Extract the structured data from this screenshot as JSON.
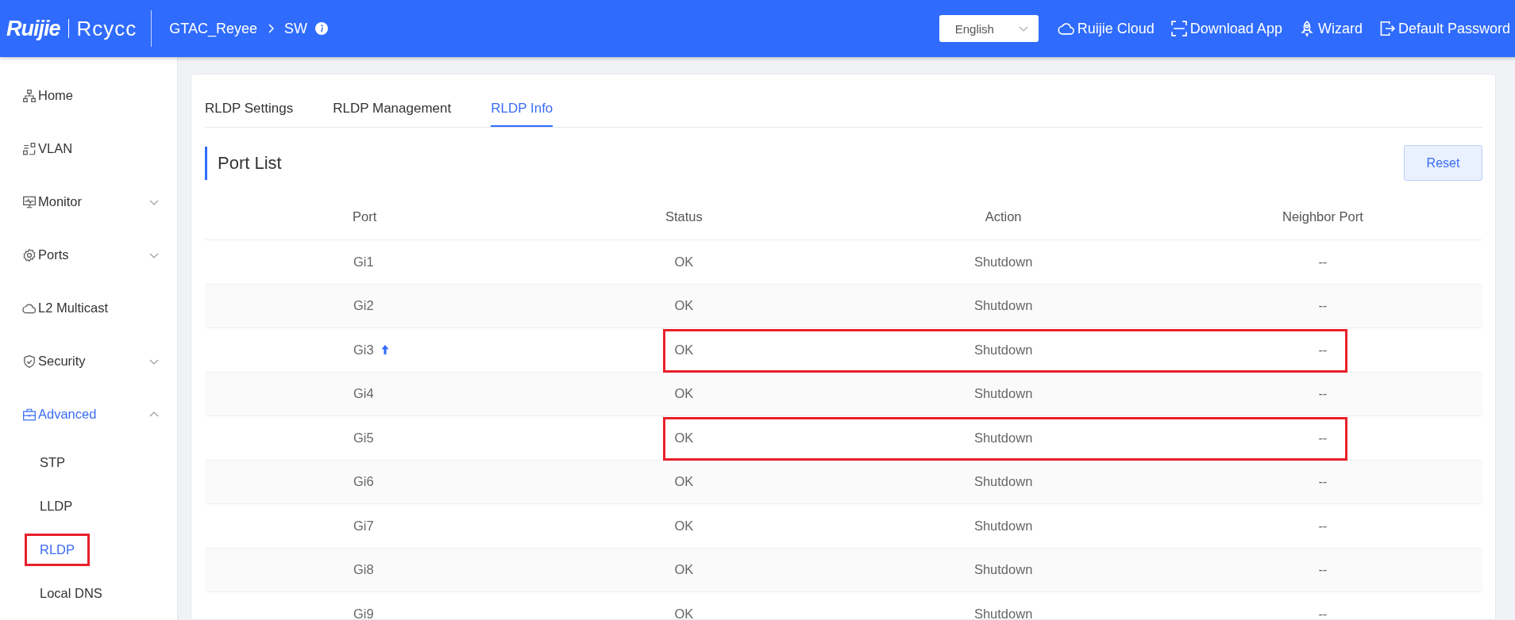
{
  "header": {
    "logo": {
      "brand": "Ruijie",
      "product": "Rcycc"
    },
    "breadcrumb": [
      {
        "label": "GTAC_Reyee"
      },
      {
        "label": "SW"
      }
    ],
    "language": {
      "value": "English"
    },
    "links": [
      {
        "label": "Ruijie Cloud"
      },
      {
        "label": "Download App"
      },
      {
        "label": "Wizard"
      },
      {
        "label": "Default Password"
      }
    ]
  },
  "sidebar": {
    "items": [
      {
        "label": "Home",
        "kind": "link",
        "selected": false
      },
      {
        "label": "VLAN",
        "kind": "link",
        "selected": false
      },
      {
        "label": "Monitor",
        "kind": "group",
        "selected": false,
        "expanded": false
      },
      {
        "label": "Ports",
        "kind": "group",
        "selected": false,
        "expanded": false
      },
      {
        "label": "L2 Multicast",
        "kind": "link",
        "selected": false
      },
      {
        "label": "Security",
        "kind": "group",
        "selected": false,
        "expanded": false
      },
      {
        "label": "Advanced",
        "kind": "group",
        "selected": true,
        "expanded": true,
        "children": [
          {
            "label": "STP",
            "selected": false,
            "highlighted": false
          },
          {
            "label": "LLDP",
            "selected": false,
            "highlighted": false
          },
          {
            "label": "RLDP",
            "selected": true,
            "highlighted": true
          },
          {
            "label": "Local DNS",
            "selected": false,
            "highlighted": false
          }
        ]
      }
    ]
  },
  "tabs": [
    {
      "label": "RLDP Settings",
      "selected": false
    },
    {
      "label": "RLDP Management",
      "selected": false
    },
    {
      "label": "RLDP Info",
      "selected": true
    }
  ],
  "section": {
    "title": "Port List",
    "reset_button": "Reset"
  },
  "table": {
    "columns": [
      "Port",
      "Status",
      "Action",
      "Neighbor Port"
    ],
    "rows": [
      {
        "port": "Gi1",
        "uplink": false,
        "status": "OK",
        "action": "Shutdown",
        "neighbor": "--",
        "highlighted": false
      },
      {
        "port": "Gi2",
        "uplink": false,
        "status": "OK",
        "action": "Shutdown",
        "neighbor": "--",
        "highlighted": false
      },
      {
        "port": "Gi3",
        "uplink": true,
        "status": "OK",
        "action": "Shutdown",
        "neighbor": "--",
        "highlighted": true
      },
      {
        "port": "Gi4",
        "uplink": false,
        "status": "OK",
        "action": "Shutdown",
        "neighbor": "--",
        "highlighted": false
      },
      {
        "port": "Gi5",
        "uplink": false,
        "status": "OK",
        "action": "Shutdown",
        "neighbor": "--",
        "highlighted": true
      },
      {
        "port": "Gi6",
        "uplink": false,
        "status": "OK",
        "action": "Shutdown",
        "neighbor": "--",
        "highlighted": false
      },
      {
        "port": "Gi7",
        "uplink": false,
        "status": "OK",
        "action": "Shutdown",
        "neighbor": "--",
        "highlighted": false
      },
      {
        "port": "Gi8",
        "uplink": false,
        "status": "OK",
        "action": "Shutdown",
        "neighbor": "--",
        "highlighted": false
      },
      {
        "port": "Gi9",
        "uplink": false,
        "status": "OK",
        "action": "Shutdown",
        "neighbor": "--",
        "highlighted": false
      }
    ]
  }
}
